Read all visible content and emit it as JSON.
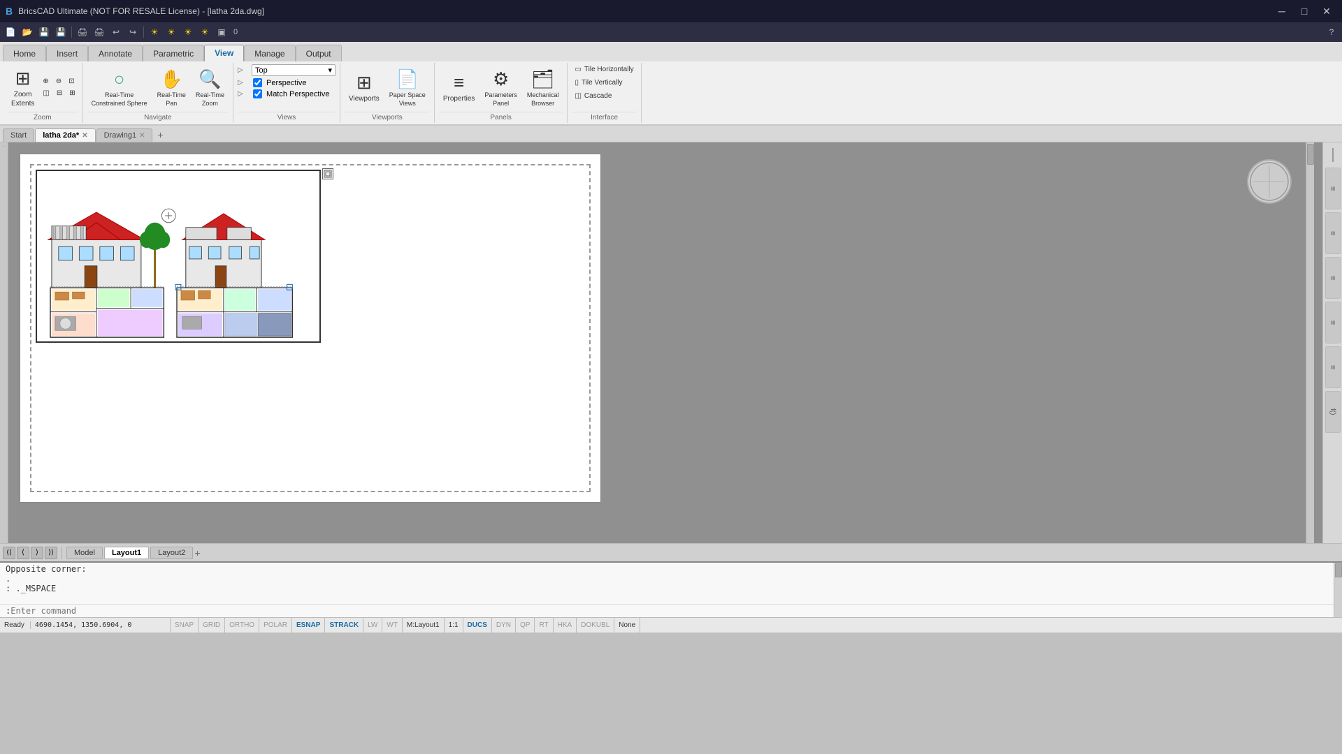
{
  "titlebar": {
    "title": "BricsCAD Ultimate (NOT FOR RESALE License) - [latha 2da.dwg]",
    "logo": "B",
    "min_btn": "─",
    "max_btn": "□",
    "close_btn": "✕"
  },
  "ribbon": {
    "tabs": [
      {
        "id": "home",
        "label": "Home"
      },
      {
        "id": "insert",
        "label": "Insert"
      },
      {
        "id": "annotate",
        "label": "Annotate"
      },
      {
        "id": "parametric",
        "label": "Parametric"
      },
      {
        "id": "view",
        "label": "View",
        "active": true
      },
      {
        "id": "manage",
        "label": "Manage"
      },
      {
        "id": "output",
        "label": "Output"
      }
    ],
    "groups": {
      "zoom": {
        "label": "Zoom",
        "buttons": [
          {
            "id": "zoom-extents",
            "icon": "⊞",
            "label": "Zoom\nExtents"
          },
          {
            "id": "zoom-row1-1",
            "icon": "⊕",
            "label": ""
          },
          {
            "id": "zoom-row1-2",
            "icon": "⊖",
            "label": ""
          },
          {
            "id": "zoom-row1-3",
            "icon": "⊡",
            "label": ""
          },
          {
            "id": "zoom-row2-1",
            "icon": "◫",
            "label": ""
          },
          {
            "id": "zoom-row2-2",
            "icon": "⊟",
            "label": ""
          },
          {
            "id": "zoom-row2-3",
            "icon": "⊞",
            "label": ""
          }
        ]
      },
      "navigate": {
        "label": "Navigate",
        "buttons": [
          {
            "id": "constrained-sphere",
            "icon": "○",
            "label": "Real-Time\nConstrained Sphere"
          },
          {
            "id": "realtime-pan",
            "icon": "✋",
            "label": "Real-Time\nPan"
          },
          {
            "id": "realtime-zoom",
            "icon": "🔍",
            "label": "Real-Time\nZoom"
          }
        ]
      },
      "views": {
        "label": "Views",
        "view_dropdown": "Top",
        "checkboxes": [
          {
            "id": "cb1",
            "checked": true,
            "label": ""
          },
          {
            "id": "cb2",
            "checked": true,
            "label": ""
          }
        ],
        "items": [
          {
            "icon": "P",
            "label": "Perspective"
          },
          {
            "icon": "M",
            "label": "Match Perspective"
          }
        ]
      },
      "viewports": {
        "label": "Viewports",
        "buttons": [
          {
            "id": "viewports",
            "icon": "⊞",
            "label": "Viewports"
          },
          {
            "id": "paper-space",
            "icon": "📄",
            "label": "Paper Space\nViews"
          }
        ]
      },
      "panels": {
        "label": "Panels",
        "buttons": [
          {
            "id": "properties",
            "icon": "≡",
            "label": "Properties"
          },
          {
            "id": "parameters-panel",
            "icon": "⚙",
            "label": "Parameters\nPanel"
          },
          {
            "id": "mechanical-browser",
            "icon": "🗂",
            "label": "Mechanical\nBrowser"
          }
        ]
      },
      "interface": {
        "label": "Interface",
        "items": [
          {
            "id": "tile-horiz",
            "label": "Tile Horizontally",
            "icon": "▭"
          },
          {
            "id": "tile-vert",
            "label": "Tile Vertically",
            "icon": "▯"
          },
          {
            "id": "cascade",
            "label": "Cascade",
            "icon": "◫"
          }
        ]
      }
    }
  },
  "doc_tabs": [
    {
      "id": "start",
      "label": "Start",
      "active": false,
      "closeable": false
    },
    {
      "id": "latha2da",
      "label": "latha 2da*",
      "active": true,
      "closeable": true
    },
    {
      "id": "drawing1",
      "label": "Drawing1",
      "active": false,
      "closeable": true
    }
  ],
  "layout_tabs": [
    {
      "id": "model",
      "label": "Model",
      "active": false
    },
    {
      "id": "layout1",
      "label": "Layout1",
      "active": true
    },
    {
      "id": "layout2",
      "label": "Layout2",
      "active": false
    }
  ],
  "command_lines": [
    "Opposite corner:",
    ".",
    ": ._MSPACE",
    ""
  ],
  "command_prompt": ": ",
  "command_input_placeholder": "Enter command",
  "statusbar": {
    "coords": "4690.1454, 1350.6904, 0",
    "items": [
      {
        "id": "snap",
        "label": "SNAP",
        "active": false
      },
      {
        "id": "grid",
        "label": "GRID",
        "active": false
      },
      {
        "id": "ortho",
        "label": "ORTHO",
        "active": false
      },
      {
        "id": "polar",
        "label": "POLAR",
        "active": false
      },
      {
        "id": "esnap",
        "label": "ESNAP",
        "active": true
      },
      {
        "id": "strack",
        "label": "STRACK",
        "active": true
      },
      {
        "id": "lw",
        "label": "LW",
        "active": false
      },
      {
        "id": "wt",
        "label": "WT",
        "active": false
      },
      {
        "id": "mlayout1",
        "label": "M:Layout1",
        "active": false
      },
      {
        "id": "scale",
        "label": "1:1",
        "active": false
      },
      {
        "id": "ducs",
        "label": "DUCS",
        "active": true
      },
      {
        "id": "dyn",
        "label": "DYN",
        "active": false
      },
      {
        "id": "qp",
        "label": "QP",
        "active": false
      },
      {
        "id": "rt",
        "label": "RT",
        "active": false
      },
      {
        "id": "hka",
        "label": "HKA",
        "active": false
      },
      {
        "id": "dokubl",
        "label": "DOKUBL",
        "active": false
      },
      {
        "id": "none",
        "label": "None",
        "active": false
      }
    ],
    "ready": "Ready"
  },
  "right_panel_tabs": [
    {
      "id": "tab1",
      "label": "≡"
    },
    {
      "id": "tab2",
      "label": "≡"
    },
    {
      "id": "tab3",
      "label": "≡"
    },
    {
      "id": "tab4",
      "label": "≡"
    },
    {
      "id": "tab5",
      "label": "≡"
    },
    {
      "id": "tab6",
      "label": "f()"
    }
  ]
}
